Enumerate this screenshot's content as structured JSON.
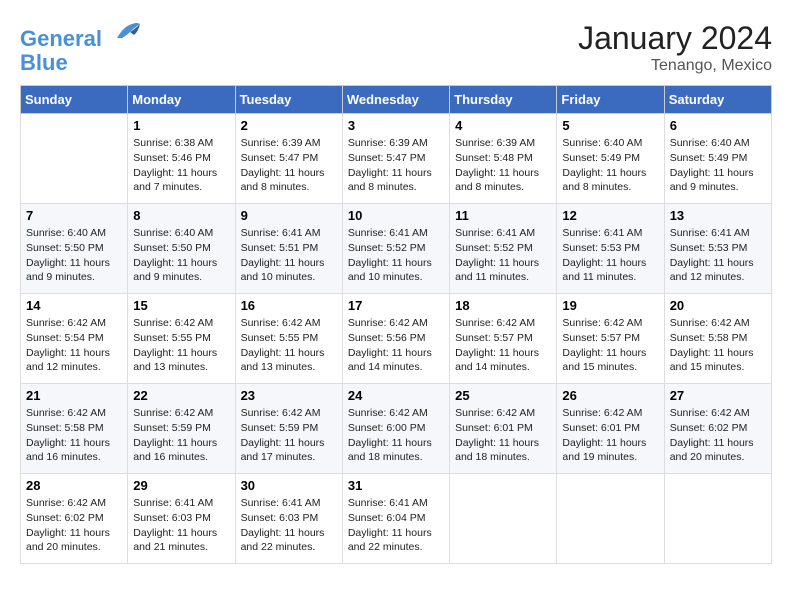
{
  "header": {
    "logo_line1": "General",
    "logo_line2": "Blue",
    "month_title": "January 2024",
    "location": "Tenango, Mexico"
  },
  "days_of_week": [
    "Sunday",
    "Monday",
    "Tuesday",
    "Wednesday",
    "Thursday",
    "Friday",
    "Saturday"
  ],
  "weeks": [
    [
      {
        "day": "",
        "content": ""
      },
      {
        "day": "1",
        "content": "Sunrise: 6:38 AM\nSunset: 5:46 PM\nDaylight: 11 hours\nand 7 minutes."
      },
      {
        "day": "2",
        "content": "Sunrise: 6:39 AM\nSunset: 5:47 PM\nDaylight: 11 hours\nand 8 minutes."
      },
      {
        "day": "3",
        "content": "Sunrise: 6:39 AM\nSunset: 5:47 PM\nDaylight: 11 hours\nand 8 minutes."
      },
      {
        "day": "4",
        "content": "Sunrise: 6:39 AM\nSunset: 5:48 PM\nDaylight: 11 hours\nand 8 minutes."
      },
      {
        "day": "5",
        "content": "Sunrise: 6:40 AM\nSunset: 5:49 PM\nDaylight: 11 hours\nand 8 minutes."
      },
      {
        "day": "6",
        "content": "Sunrise: 6:40 AM\nSunset: 5:49 PM\nDaylight: 11 hours\nand 9 minutes."
      }
    ],
    [
      {
        "day": "7",
        "content": "Sunrise: 6:40 AM\nSunset: 5:50 PM\nDaylight: 11 hours\nand 9 minutes."
      },
      {
        "day": "8",
        "content": "Sunrise: 6:40 AM\nSunset: 5:50 PM\nDaylight: 11 hours\nand 9 minutes."
      },
      {
        "day": "9",
        "content": "Sunrise: 6:41 AM\nSunset: 5:51 PM\nDaylight: 11 hours\nand 10 minutes."
      },
      {
        "day": "10",
        "content": "Sunrise: 6:41 AM\nSunset: 5:52 PM\nDaylight: 11 hours\nand 10 minutes."
      },
      {
        "day": "11",
        "content": "Sunrise: 6:41 AM\nSunset: 5:52 PM\nDaylight: 11 hours\nand 11 minutes."
      },
      {
        "day": "12",
        "content": "Sunrise: 6:41 AM\nSunset: 5:53 PM\nDaylight: 11 hours\nand 11 minutes."
      },
      {
        "day": "13",
        "content": "Sunrise: 6:41 AM\nSunset: 5:53 PM\nDaylight: 11 hours\nand 12 minutes."
      }
    ],
    [
      {
        "day": "14",
        "content": "Sunrise: 6:42 AM\nSunset: 5:54 PM\nDaylight: 11 hours\nand 12 minutes."
      },
      {
        "day": "15",
        "content": "Sunrise: 6:42 AM\nSunset: 5:55 PM\nDaylight: 11 hours\nand 13 minutes."
      },
      {
        "day": "16",
        "content": "Sunrise: 6:42 AM\nSunset: 5:55 PM\nDaylight: 11 hours\nand 13 minutes."
      },
      {
        "day": "17",
        "content": "Sunrise: 6:42 AM\nSunset: 5:56 PM\nDaylight: 11 hours\nand 14 minutes."
      },
      {
        "day": "18",
        "content": "Sunrise: 6:42 AM\nSunset: 5:57 PM\nDaylight: 11 hours\nand 14 minutes."
      },
      {
        "day": "19",
        "content": "Sunrise: 6:42 AM\nSunset: 5:57 PM\nDaylight: 11 hours\nand 15 minutes."
      },
      {
        "day": "20",
        "content": "Sunrise: 6:42 AM\nSunset: 5:58 PM\nDaylight: 11 hours\nand 15 minutes."
      }
    ],
    [
      {
        "day": "21",
        "content": "Sunrise: 6:42 AM\nSunset: 5:58 PM\nDaylight: 11 hours\nand 16 minutes."
      },
      {
        "day": "22",
        "content": "Sunrise: 6:42 AM\nSunset: 5:59 PM\nDaylight: 11 hours\nand 16 minutes."
      },
      {
        "day": "23",
        "content": "Sunrise: 6:42 AM\nSunset: 5:59 PM\nDaylight: 11 hours\nand 17 minutes."
      },
      {
        "day": "24",
        "content": "Sunrise: 6:42 AM\nSunset: 6:00 PM\nDaylight: 11 hours\nand 18 minutes."
      },
      {
        "day": "25",
        "content": "Sunrise: 6:42 AM\nSunset: 6:01 PM\nDaylight: 11 hours\nand 18 minutes."
      },
      {
        "day": "26",
        "content": "Sunrise: 6:42 AM\nSunset: 6:01 PM\nDaylight: 11 hours\nand 19 minutes."
      },
      {
        "day": "27",
        "content": "Sunrise: 6:42 AM\nSunset: 6:02 PM\nDaylight: 11 hours\nand 20 minutes."
      }
    ],
    [
      {
        "day": "28",
        "content": "Sunrise: 6:42 AM\nSunset: 6:02 PM\nDaylight: 11 hours\nand 20 minutes."
      },
      {
        "day": "29",
        "content": "Sunrise: 6:41 AM\nSunset: 6:03 PM\nDaylight: 11 hours\nand 21 minutes."
      },
      {
        "day": "30",
        "content": "Sunrise: 6:41 AM\nSunset: 6:03 PM\nDaylight: 11 hours\nand 22 minutes."
      },
      {
        "day": "31",
        "content": "Sunrise: 6:41 AM\nSunset: 6:04 PM\nDaylight: 11 hours\nand 22 minutes."
      },
      {
        "day": "",
        "content": ""
      },
      {
        "day": "",
        "content": ""
      },
      {
        "day": "",
        "content": ""
      }
    ]
  ]
}
